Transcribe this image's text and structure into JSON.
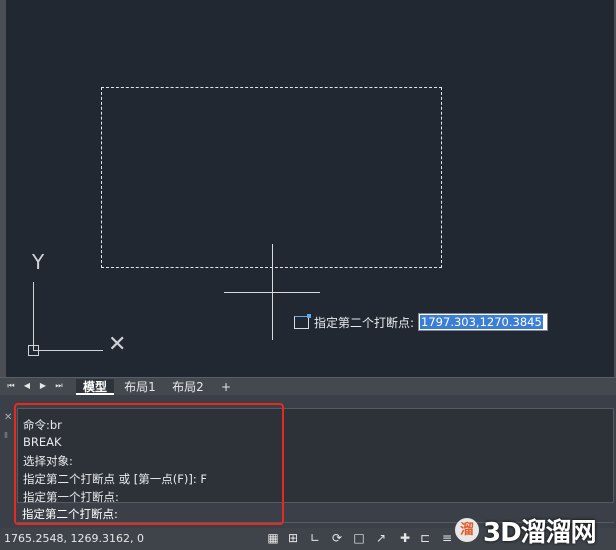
{
  "ucs": {
    "y_label": "Y",
    "x_label": "✕"
  },
  "dynamic_input": {
    "prompt": "指定第二个打断点:",
    "value": "1797.303,1270.3845"
  },
  "layout_tabs": {
    "nav_first": "⏮",
    "nav_prev": "◀",
    "nav_next": "▶",
    "nav_last": "⏭",
    "tabs": [
      "模型",
      "布局1",
      "布局2"
    ],
    "active_tab": "模型",
    "add": "+"
  },
  "command_window": {
    "close": "✕",
    "pin": "Ⅱ",
    "history": [
      "命令:br",
      "BREAK",
      "选择对象:",
      "指定第二个打断点 或 [第一点(F)]: F",
      "指定第一个打断点:"
    ],
    "current_prompt": "指定第二个打断点:"
  },
  "status_bar": {
    "coordinates": "1765.2548, 1269.3162, 0",
    "buttons": [
      "▦",
      "⊞",
      "∟",
      "⟳",
      "□",
      "↗",
      "✚",
      "⊏",
      "≡",
      "⊡",
      "♦"
    ]
  },
  "watermark": {
    "logo": "溜",
    "text": "3D溜溜网"
  },
  "colors": {
    "viewport_bg": "#212831",
    "highlight_box": "#e8291f",
    "selection_dash": "#e6e6e6",
    "input_selection": "#3b7ed5"
  }
}
